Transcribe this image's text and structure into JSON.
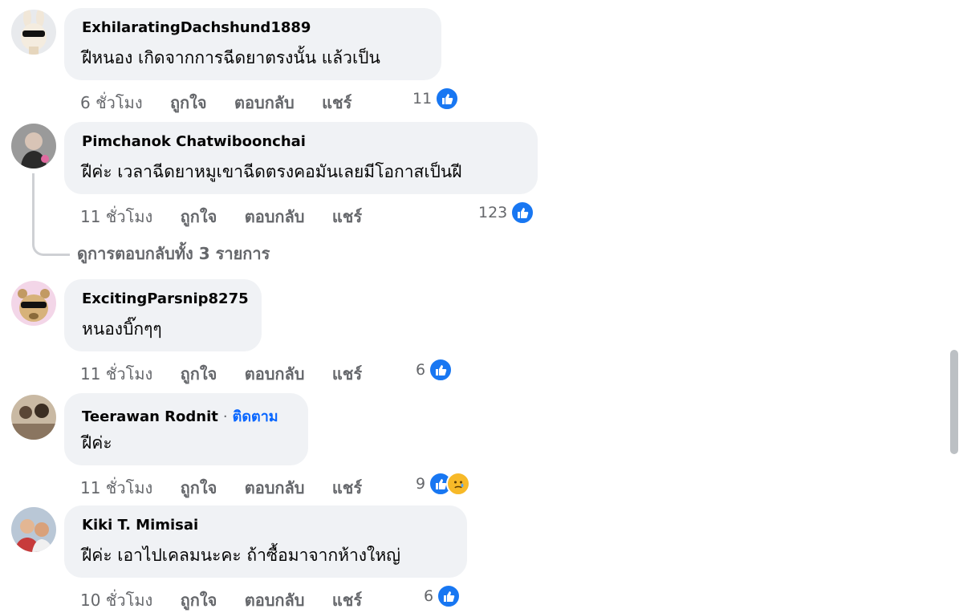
{
  "comments": [
    {
      "author": "ExhilaratingDachshund1889",
      "text": "ฝีหนอง เกิดจากการฉีดยาตรงนั้น แล้วเป็น",
      "time": "6 ชั่วโมง",
      "like": "ถูกใจ",
      "reply": "ตอบกลับ",
      "share": "แชร์",
      "reaction_count": "11",
      "reactions": [
        "like-icon"
      ]
    },
    {
      "author": "Pimchanok Chatwiboonchai",
      "text": "ฝีค่ะ เวลาฉีดยาหมูเขาฉีดตรงคอมันเลยมีโอกาสเป็นฝี",
      "time": "11 ชั่วโมง",
      "like": "ถูกใจ",
      "reply": "ตอบกลับ",
      "share": "แชร์",
      "reaction_count": "123",
      "reactions": [
        "like-icon"
      ],
      "view_replies": "ดูการตอบกลับทั้ง 3 รายการ"
    },
    {
      "author": "ExcitingParsnip8275",
      "text": "หนองบิ๊กๆๆ",
      "time": "11 ชั่วโมง",
      "like": "ถูกใจ",
      "reply": "ตอบกลับ",
      "share": "แชร์",
      "reaction_count": "6",
      "reactions": [
        "like-icon"
      ]
    },
    {
      "author": "Teerawan Rodnit",
      "follow": "ติดตาม",
      "separator": "·",
      "text": "ฝีค่ะ",
      "time": "11 ชั่วโมง",
      "like": "ถูกใจ",
      "reply": "ตอบกลับ",
      "share": "แชร์",
      "reaction_count": "9",
      "reactions": [
        "like-icon",
        "sad-icon"
      ]
    },
    {
      "author": "Kiki T. Mimisai",
      "text": "ฝีค่ะ เอาไปเคลมนะคะ ถ้าซื้อมาจากห้างใหญ่",
      "time": "10 ชั่วโมง",
      "like": "ถูกใจ",
      "reply": "ตอบกลับ",
      "share": "แชร์",
      "reaction_count": "6",
      "reactions": [
        "like-icon"
      ]
    }
  ],
  "colors": {
    "bubble": "#f0f2f5",
    "secondary_text": "#65676b",
    "like_blue": "#1877f2",
    "follow_blue": "#0866ff",
    "sad_yellow": "#f7b928"
  }
}
